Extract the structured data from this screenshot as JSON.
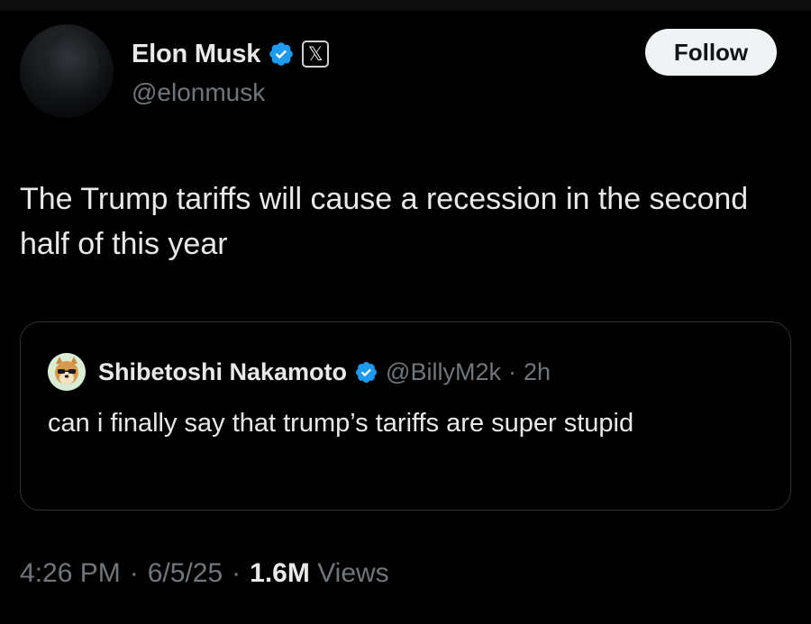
{
  "tweet": {
    "author": {
      "name": "Elon Musk",
      "handle": "@elonmusk",
      "verified": true,
      "affiliate_badge": "𝕏"
    },
    "follow_label": "Follow",
    "text": "The Trump tariffs will cause a recession in the second half of this year",
    "quoted": {
      "name": "Shibetoshi Nakamoto",
      "handle": "@BillyM2k",
      "separator": "·",
      "time": "2h",
      "verified": true,
      "text": "can i finally say that trump’s tariffs are super stupid"
    },
    "meta": {
      "time": "4:26 PM",
      "sep1": "·",
      "date": "6/5/25",
      "sep2": "·",
      "views_count": "1.6M",
      "views_label": "Views"
    }
  },
  "colors": {
    "background": "#000000",
    "verified_blue": "#1d9bf0",
    "text_primary": "#e7e9ea",
    "text_secondary": "#71767b",
    "card_border": "#2f3336",
    "follow_bg": "#eff3f4"
  },
  "icons": {
    "verified": "verified-badge-icon",
    "affiliate": "x-logo-icon",
    "quoted_avatar": "shiba-dog-avatar"
  }
}
